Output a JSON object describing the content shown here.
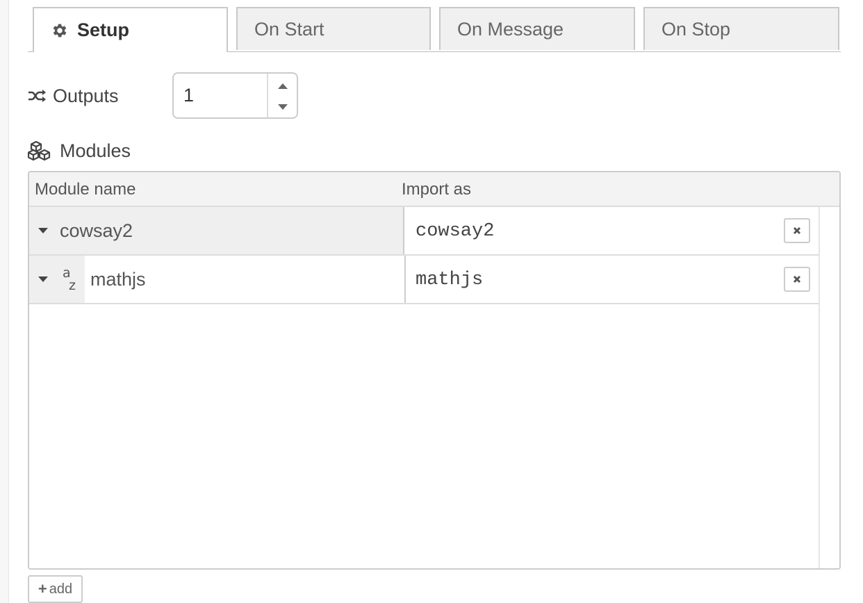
{
  "tabs": [
    {
      "label": "Setup",
      "icon": "gear-icon",
      "active": true
    },
    {
      "label": "On Start",
      "active": false
    },
    {
      "label": "On Message",
      "active": false
    },
    {
      "label": "On Stop",
      "active": false
    }
  ],
  "outputs": {
    "label": "Outputs",
    "icon": "random-icon",
    "value": "1"
  },
  "modules": {
    "label": "Modules",
    "icon": "cubes-icon",
    "columns": {
      "name": "Module name",
      "import_as": "Import as"
    },
    "rows": [
      {
        "name": "cowsay2",
        "import_as": "cowsay2"
      },
      {
        "name": "mathjs",
        "import_as": "mathjs"
      }
    ]
  },
  "add_button": {
    "label": "add"
  },
  "colors": {
    "tab_bg": "#f0f0f0",
    "border": "#cccccc",
    "text": "#555555"
  }
}
